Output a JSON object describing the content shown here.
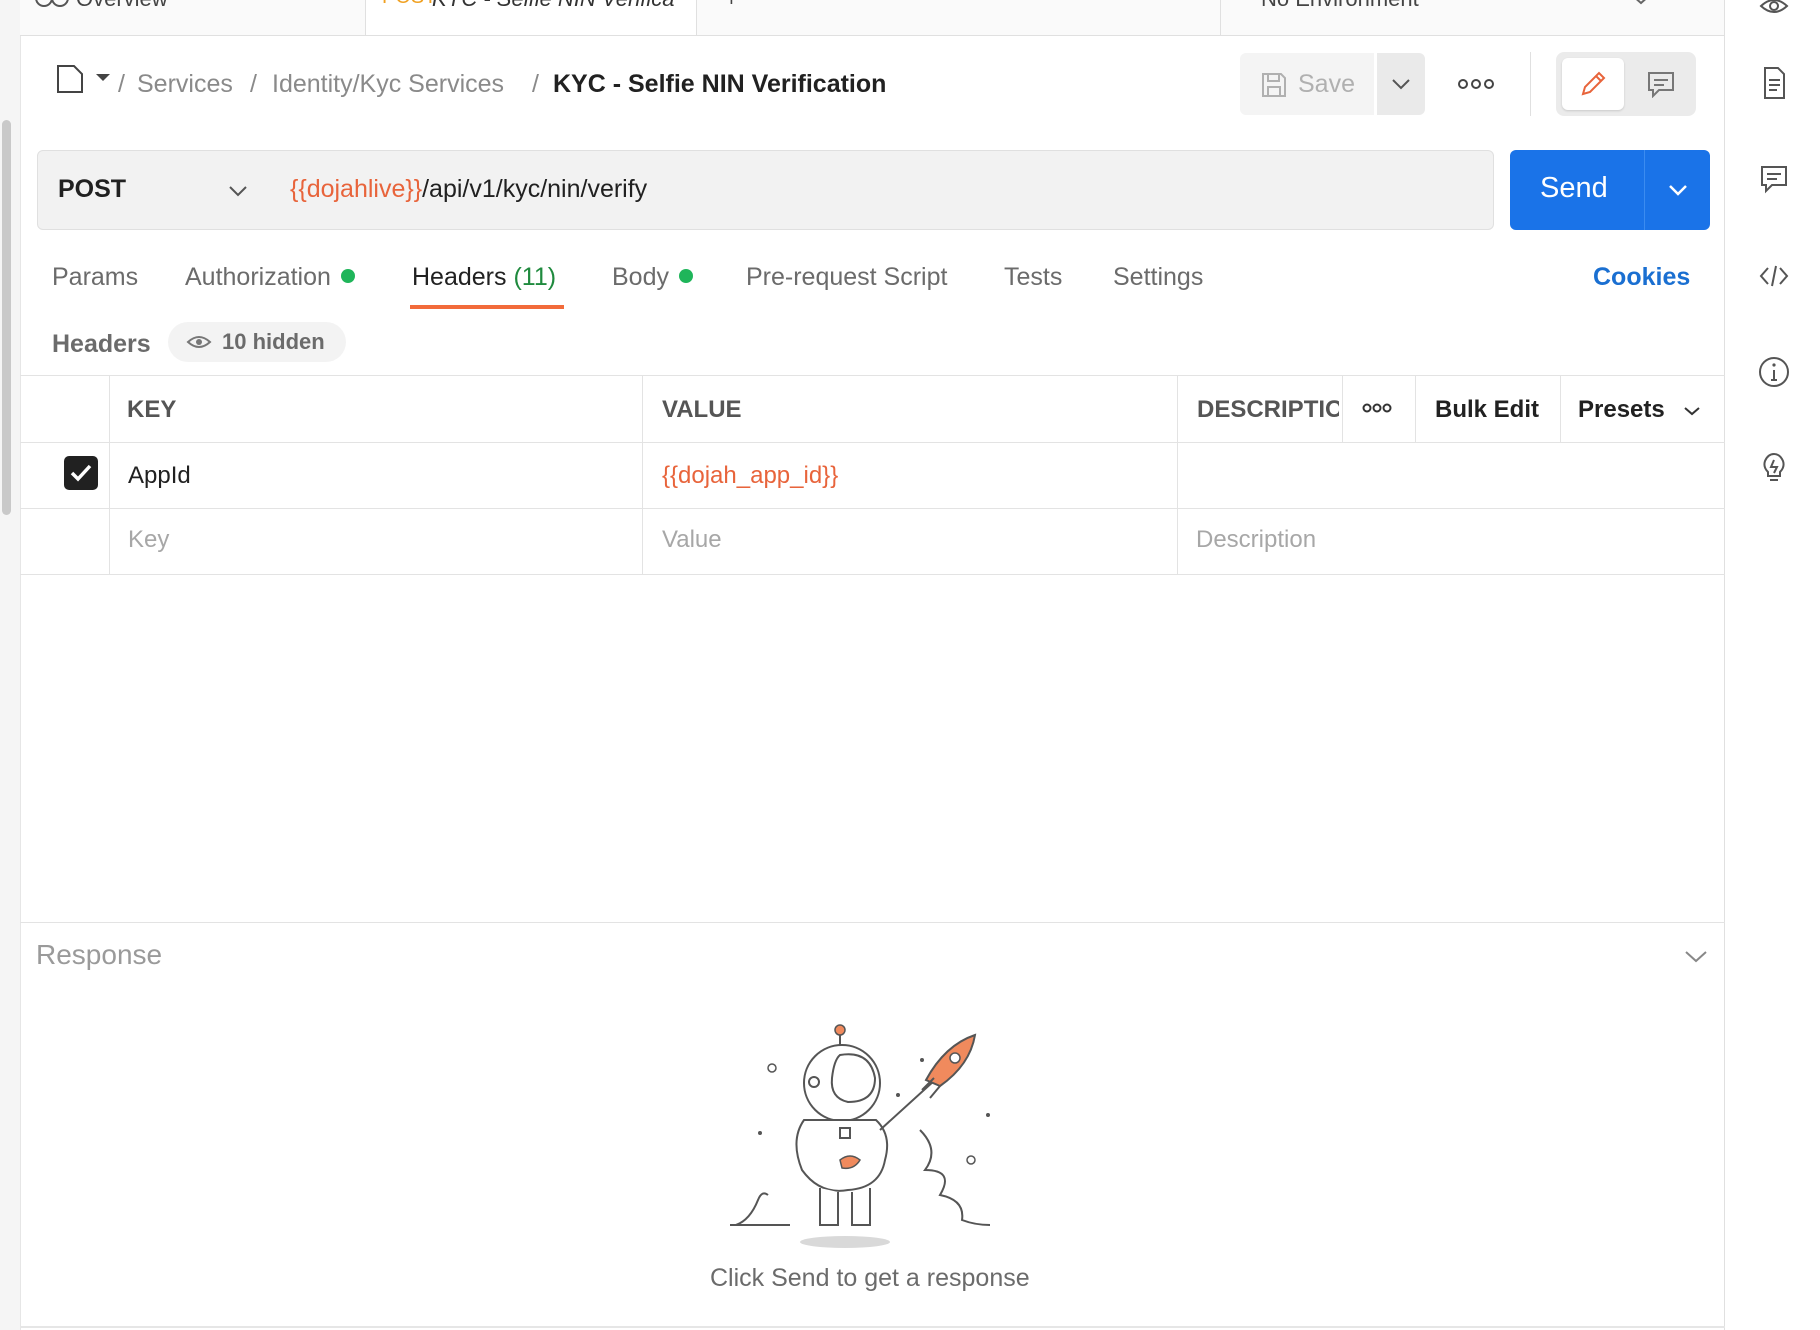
{
  "tabs": {
    "overview_label": "Overview",
    "active_method": "POST",
    "active_label": "KYC - Selfie NIN Verifica",
    "add_label": "+",
    "environment_label": "No Environment"
  },
  "breadcrumb": {
    "items": [
      "Services",
      "Identity/Kyc Services"
    ],
    "current": "KYC - Selfie NIN Verification",
    "separator": "/"
  },
  "toolbar": {
    "save_label": "Save",
    "more_label": "ooo"
  },
  "request": {
    "method": "POST",
    "url_variable": "{{dojahlive}}",
    "url_path": "/api/v1/kyc/nin/verify",
    "send_label": "Send"
  },
  "request_tabs": {
    "params": "Params",
    "authorization": "Authorization",
    "headers": "Headers",
    "headers_count": "(11)",
    "body": "Body",
    "prerequest": "Pre-request Script",
    "tests": "Tests",
    "settings": "Settings",
    "cookies": "Cookies"
  },
  "headers_section": {
    "label": "Headers",
    "hidden_label": "10 hidden"
  },
  "table": {
    "col_key": "KEY",
    "col_value": "VALUE",
    "col_description": "DESCRIPTIO",
    "more_label": "ooo",
    "bulk_edit": "Bulk Edit",
    "presets": "Presets",
    "rows": [
      {
        "checked": true,
        "key": "AppId",
        "value": "{{dojah_app_id}}",
        "description": ""
      }
    ],
    "placeholders": {
      "key": "Key",
      "value": "Value",
      "description": "Description"
    }
  },
  "response": {
    "label": "Response",
    "hint": "Click Send to get a response"
  },
  "colors": {
    "accent_blue": "#1a73e8",
    "variable_orange": "#e8643b",
    "active_tab_underline": "#f26b3a",
    "status_green": "#1fb55a"
  }
}
